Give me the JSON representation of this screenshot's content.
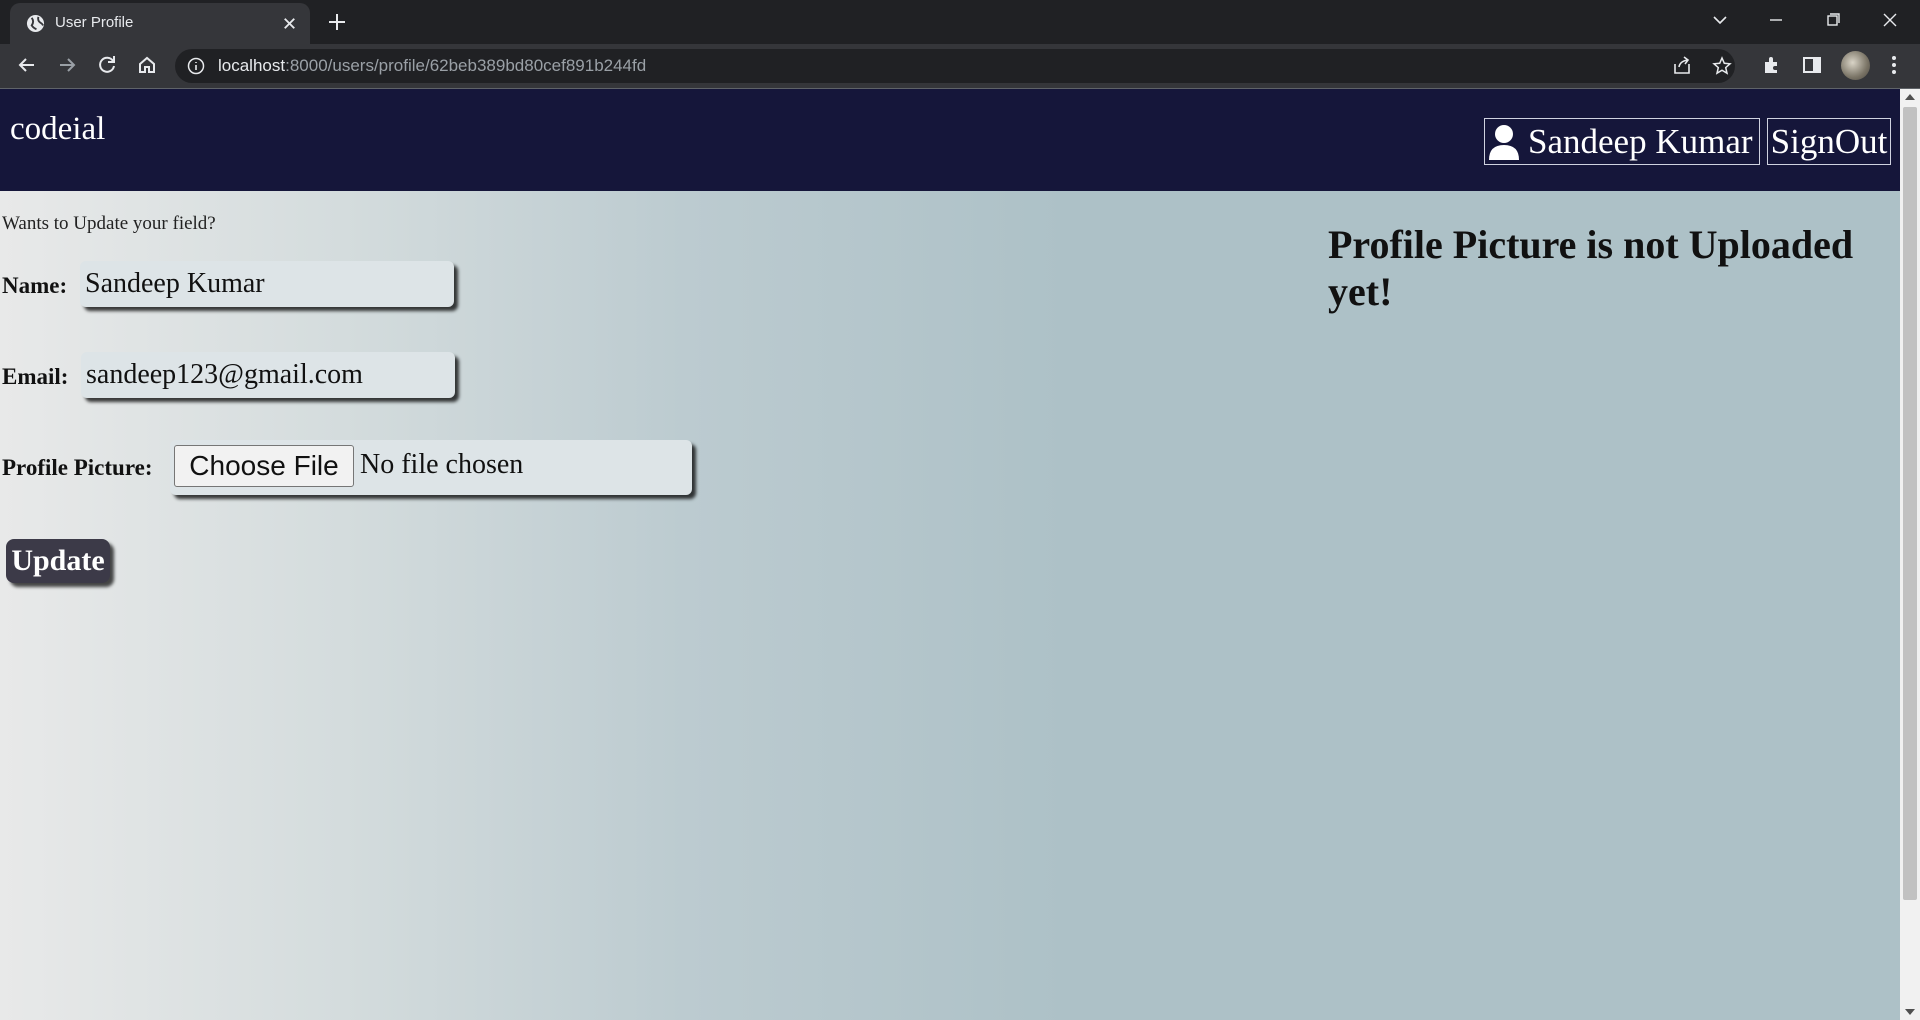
{
  "browser": {
    "tab_title": "User Profile",
    "url_host": "localhost",
    "url_path": ":8000/users/profile/62beb389bd80cef891b244fd"
  },
  "header": {
    "logo": "codeial",
    "user_name": "Sandeep Kumar",
    "signout_label": "SignOut"
  },
  "form": {
    "hint": "Wants to Update your field?",
    "name_label": "Name:",
    "name_value": "Sandeep Kumar",
    "email_label": "Email:",
    "email_value": "sandeep123@gmail.com",
    "picture_label": "Profile Picture:",
    "choose_file_label": "Choose File",
    "file_status": "No file chosen",
    "update_label": "Update"
  },
  "profile_picture": {
    "message": "Profile Picture is not Uploaded yet!"
  },
  "colors": {
    "header_bg": "#15163a",
    "button_bg": "#3c3a48"
  }
}
